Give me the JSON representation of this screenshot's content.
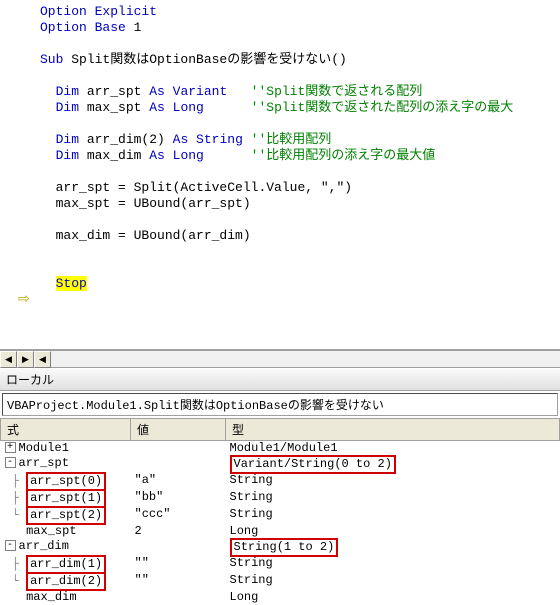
{
  "code": {
    "l1a": "Option Explicit",
    "l2a": "Option Base ",
    "l2b": "1",
    "l4a": "Sub ",
    "l4b": "Split関数はOptionBaseの影響を受けない()",
    "l6a": "Dim ",
    "l6b": "arr_spt ",
    "l6c": "As Variant",
    "l6d": "   ''Split関数で返される配列",
    "l7a": "Dim ",
    "l7b": "max_spt ",
    "l7c": "As Long",
    "l7d": "      ''Split関数で返された配列の添え字の最大",
    "l9a": "Dim ",
    "l9b": "arr_dim(2) ",
    "l9c": "As String",
    "l9d": " ''比較用配列",
    "l10a": "Dim ",
    "l10b": "max_dim ",
    "l10c": "As Long",
    "l10d": "      ''比較用配列の添え字の最大値",
    "l12": "arr_spt = Split(ActiveCell.Value, \",\")",
    "l13": "max_spt = UBound(arr_spt)",
    "l15": "max_dim = UBound(arr_dim)",
    "stop": "Stop"
  },
  "locals": {
    "title": "ローカル",
    "context": "VBAProject.Module1.Split関数はOptionBaseの影響を受けない",
    "headers": {
      "expr": "式",
      "val": "値",
      "type": "型"
    },
    "rows": {
      "module": {
        "expr": "Module1",
        "type": "Module1/Module1"
      },
      "arr_spt": {
        "expr": "arr_spt",
        "type": "Variant/String(0 to 2)"
      },
      "arr_spt_0": {
        "expr": "arr_spt(0)",
        "val": "\"a\"",
        "type": "String"
      },
      "arr_spt_1": {
        "expr": "arr_spt(1)",
        "val": "\"bb\"",
        "type": "String"
      },
      "arr_spt_2": {
        "expr": "arr_spt(2)",
        "val": "\"ccc\"",
        "type": "String"
      },
      "max_spt": {
        "expr": "max_spt",
        "val": "2",
        "type": "Long"
      },
      "arr_dim": {
        "expr": "arr_dim",
        "type": "String(1 to 2)"
      },
      "arr_dim_1": {
        "expr": "arr_dim(1)",
        "val": "\"\"",
        "type": "String"
      },
      "arr_dim_2": {
        "expr": "arr_dim(2)",
        "val": "\"\"",
        "type": "String"
      },
      "max_dim": {
        "expr": "max_dim",
        "type": "Long"
      }
    }
  },
  "glyphs": {
    "plus": "+",
    "minus": "-",
    "arrow": "⇨",
    "left": "◀",
    "right": "▶"
  }
}
